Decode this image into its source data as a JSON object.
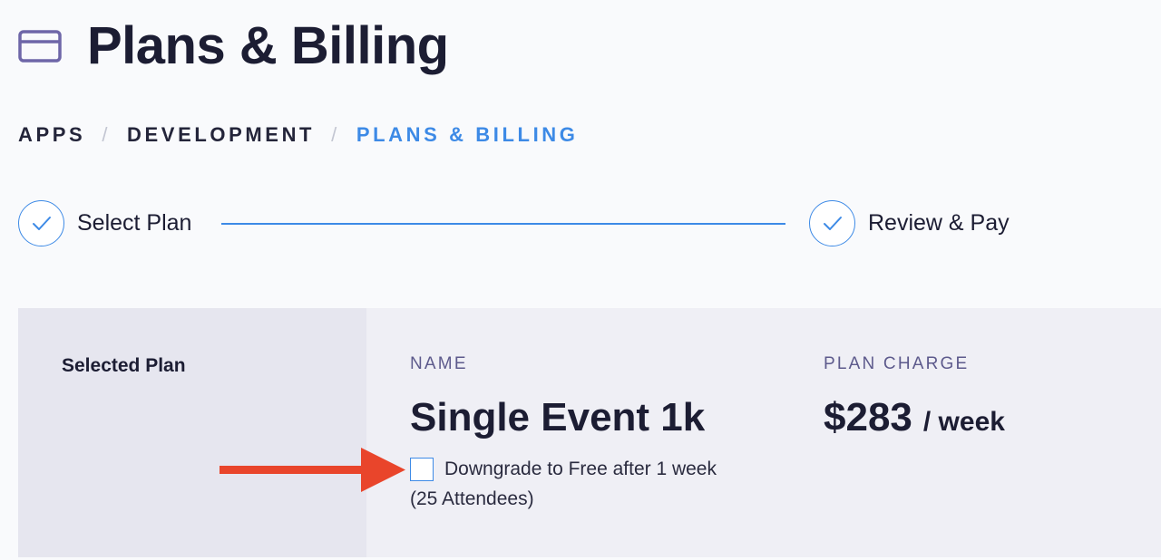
{
  "header": {
    "title": "Plans & Billing",
    "icon": "credit-card-icon",
    "icon_color": "#6e66a8"
  },
  "breadcrumb": [
    {
      "label": "APPS"
    },
    {
      "label": "DEVELOPMENT"
    },
    {
      "label": "PLANS & BILLING",
      "active": true
    }
  ],
  "breadcrumb_separator": "/",
  "stepper": {
    "steps": [
      {
        "label": "Select Plan",
        "icon": "check-icon",
        "completed": true
      },
      {
        "label": "Review & Pay",
        "icon": "check-icon",
        "completed": true
      }
    ]
  },
  "plan": {
    "side_heading": "Selected Plan",
    "name_label": "NAME",
    "name": "Single Event 1k",
    "charge_label": "PLAN CHARGE",
    "price": "$283",
    "period": "/ week",
    "downgrade": {
      "checked": false,
      "line1": "Downgrade to Free after 1 week",
      "line2": "(25 Attendees)"
    }
  },
  "annotation": {
    "icon": "arrow-right-icon",
    "color": "#e9452b"
  },
  "colors": {
    "accent": "#3d8ae6",
    "text": "#1c1d33",
    "label": "#5d5a8c",
    "background": "#f9fafc",
    "panel": "#efeff5",
    "panel_side": "#e6e6ef"
  }
}
